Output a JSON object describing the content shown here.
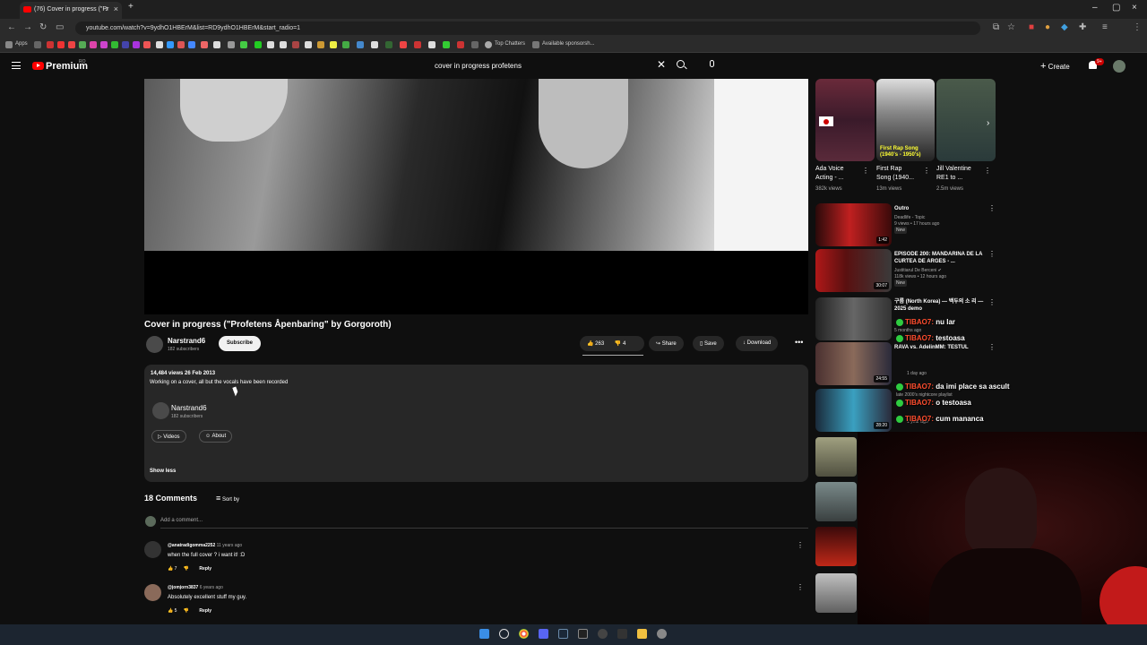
{
  "browser": {
    "tab_title": "(76) Cover in progress (\"Pr",
    "url": "youtube.com/watch?v=9ydhO1HBErM&list=RD9ydhO1HBErM&start_radio=1",
    "bookmarks": [
      "Apps",
      "Top Chatters",
      "Available sponsorsh..."
    ]
  },
  "header": {
    "brand": "Premium",
    "country": "RO",
    "search_query": "cover in progress profetens",
    "create_label": "Create",
    "notifications": "9+"
  },
  "video": {
    "title": "Cover in progress (\"Profetens Åpenbaring\" by Gorgoroth)",
    "channel": "Narstrand6",
    "subscribers": "182 subscribers",
    "subscribe_label": "Subscribe",
    "likes": "263",
    "dislikes": "4",
    "share_label": "Share",
    "save_label": "Save",
    "download_label": "Download"
  },
  "description": {
    "stats": "14,484 views  26 Feb 2013",
    "text": "Working on a cover, all but the vocals have been recorded",
    "channel": "Narstrand6",
    "subscribers": "182 subscribers",
    "videos_label": "Videos",
    "about_label": "About",
    "show_less": "Show less"
  },
  "comments": {
    "count": "18 Comments",
    "sort_label": "Sort by",
    "add_placeholder": "Add a comment...",
    "items": [
      {
        "user": "@anatradigomma2252",
        "time": "11 years ago",
        "text": "when the full cover ? i want it! :D",
        "likes": "7",
        "reply": "Reply"
      },
      {
        "user": "@jomjorn3837",
        "time": "6 years ago",
        "text": "Absolutely excellent stuff my guy.",
        "likes": "5",
        "reply": "Reply"
      }
    ]
  },
  "shorts": [
    {
      "title_1": "Ada Voice",
      "title_2": "Acting - ...",
      "views": "382k views"
    },
    {
      "title_1": "First Rap",
      "title_2": "Song (1940...",
      "views": "13m views",
      "overlay": "First Rap Song (1940's - 1950's)"
    },
    {
      "title_1": "Jill Valentine",
      "title_2": "RE1 to ...",
      "views": "2.5m views"
    }
  ],
  "recommended": [
    {
      "title": "Outro",
      "channel": "Deadlife - Topic",
      "meta": "9 views • 17 hours ago",
      "badge": "New",
      "duration": "1:42"
    },
    {
      "title": "EPISODE 200: MANDARINA DE LA CURTEA DE ARGES - ...",
      "channel": "Justitiarul De Berceni",
      "meta": "118k views • 12 hours ago",
      "badge": "New",
      "duration": "30:07"
    },
    {
      "title": "구름 (North Korea) — 백두의 소 리 — 2025 demo",
      "channel": "",
      "meta": "",
      "badge": "",
      "duration": ""
    },
    {
      "title": "RAVA vs. AdelinMM: TESTUL",
      "channel": "",
      "meta": "5 months ago",
      "badge": "",
      "duration": "24:55"
    }
  ],
  "chat": [
    {
      "name": "TIBAO7:",
      "message": "nu lar"
    },
    {
      "name": "TIBAO7:",
      "message": "testoasa"
    },
    {
      "name": "TIBAO7:",
      "message": "da imi place sa ascult"
    },
    {
      "name": "TIBAO7:",
      "message": "o testoasa"
    },
    {
      "name": "TIBAO7:",
      "message": "cum mananca"
    }
  ],
  "chat_fragments": [
    "late 2000's nightcore playlist",
    "1 year ago",
    "1 day ago",
    "28:20"
  ]
}
